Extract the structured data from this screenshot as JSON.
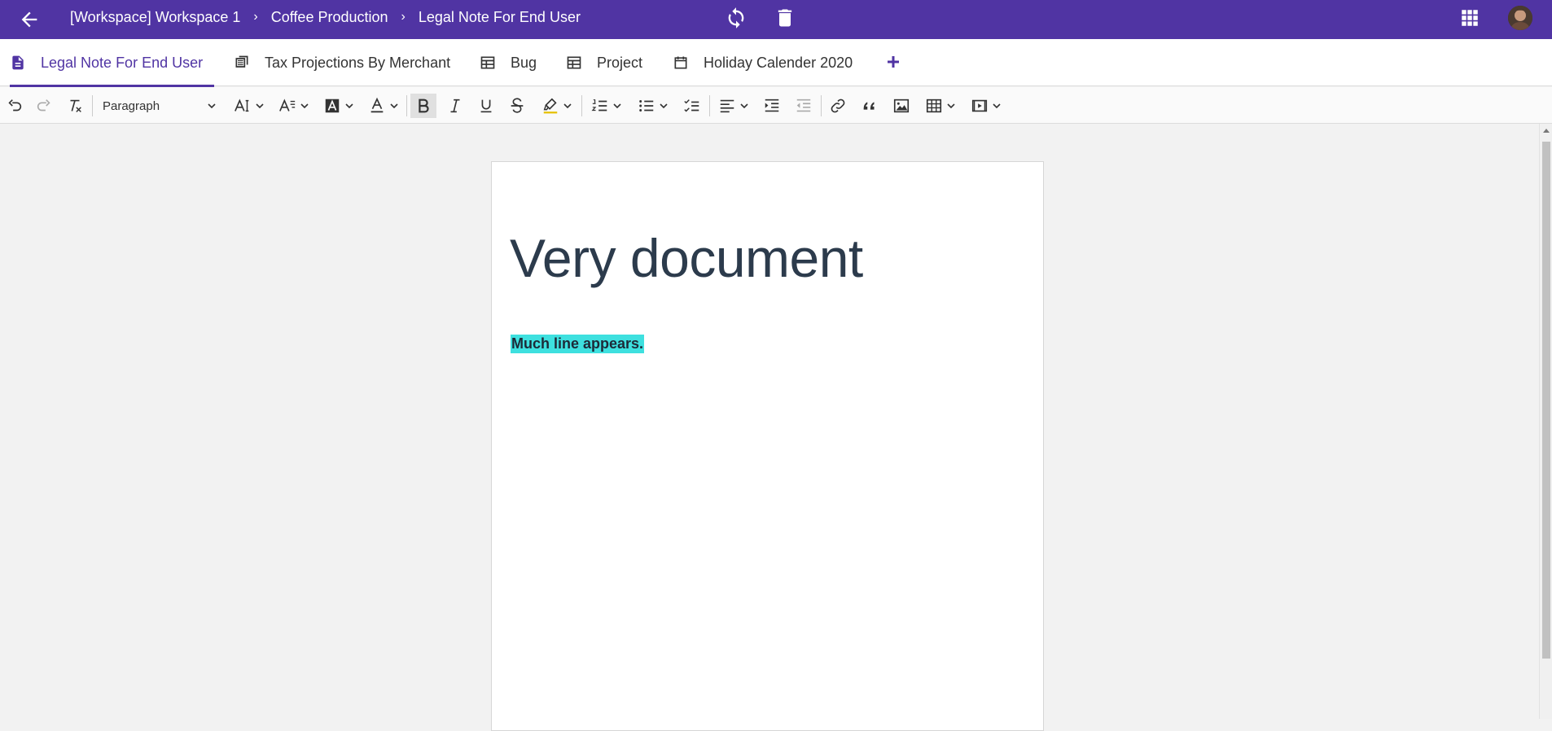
{
  "header": {
    "breadcrumbs": [
      "[Workspace] Workspace 1",
      "Coffee Production",
      "Legal Note For End User"
    ],
    "separator": "›",
    "accent": "#5034a3"
  },
  "tabs": [
    {
      "label": "Legal Note For End User",
      "icon": "document-icon",
      "active": true
    },
    {
      "label": "Tax Projections By Merchant",
      "icon": "layers-icon",
      "active": false
    },
    {
      "label": "Bug",
      "icon": "table-icon",
      "active": false
    },
    {
      "label": "Project",
      "icon": "table-icon",
      "active": false
    },
    {
      "label": "Holiday Calender 2020",
      "icon": "calendar-icon",
      "active": false
    }
  ],
  "toolbar": {
    "paragraph_style": "Paragraph",
    "bold_active": true
  },
  "document": {
    "title": "Very document",
    "line": "Much line appears.",
    "highlight_color": "#3ee0df"
  }
}
